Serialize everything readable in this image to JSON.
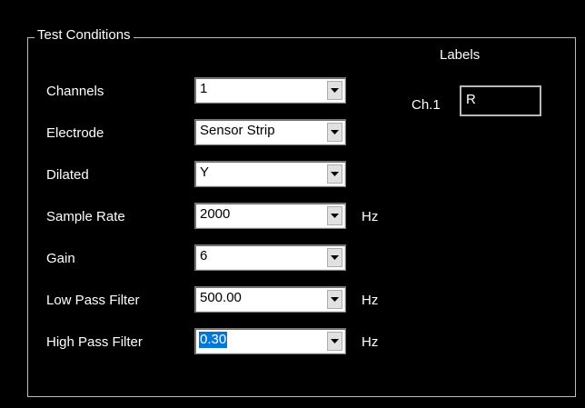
{
  "panel": {
    "title": "Test Conditions",
    "labels_heading": "Labels"
  },
  "rows": [
    {
      "label": "Channels",
      "value": "1",
      "unit": ""
    },
    {
      "label": "Electrode",
      "value": "Sensor Strip",
      "unit": ""
    },
    {
      "label": "Dilated",
      "value": "Y",
      "unit": ""
    },
    {
      "label": "Sample Rate",
      "value": "2000",
      "unit": "Hz"
    },
    {
      "label": "Gain",
      "value": "6",
      "unit": ""
    },
    {
      "label": "Low Pass Filter",
      "value": "500.00",
      "unit": "Hz"
    },
    {
      "label": "High Pass Filter",
      "value": "0.30",
      "unit": "Hz"
    }
  ],
  "channel_labels": [
    {
      "label": "Ch.1",
      "value": "R"
    }
  ],
  "icons": {
    "dropdown": "chevron-down-icon"
  },
  "colors": {
    "background": "#000000",
    "border": "#bdbdbd",
    "selection": "#0078d7"
  }
}
